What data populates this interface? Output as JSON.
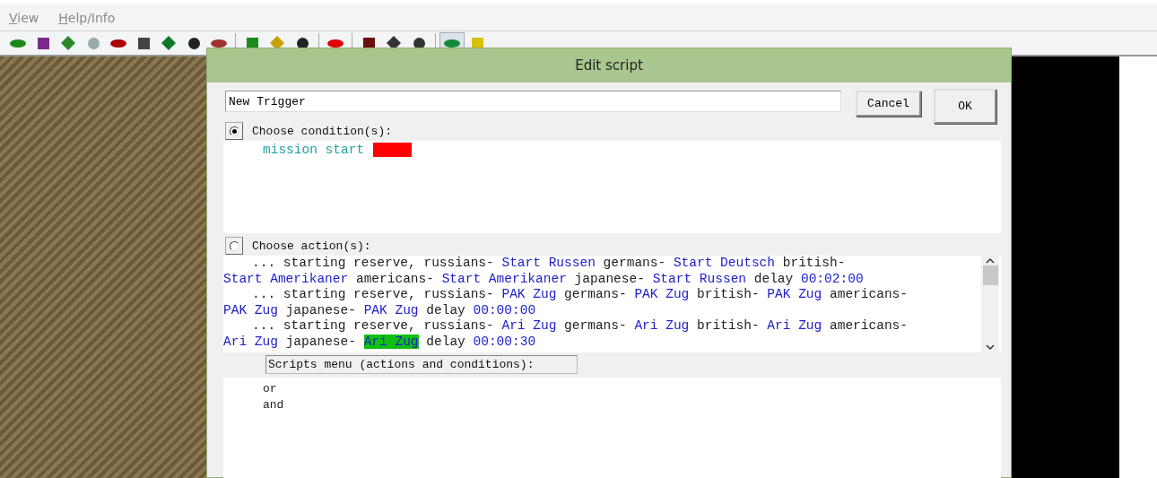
{
  "menu": [
    "View",
    "Help/Info"
  ],
  "toolbar_buttons": [
    {
      "selected": false
    },
    {
      "selected": false
    },
    {
      "selected": false
    },
    {
      "selected": false
    },
    {
      "selected": false
    },
    {
      "selected": false
    },
    {
      "selected": false
    },
    {
      "selected": false
    },
    {
      "selected": false
    },
    {
      "selected": false
    },
    {
      "selected": false
    },
    {
      "selected": false
    },
    {
      "selected": false
    },
    {
      "selected": false
    },
    {
      "selected": false
    },
    {
      "selected": false
    },
    {
      "selected": true
    },
    {
      "selected": false
    }
  ],
  "dialog": {
    "title": "Edit script",
    "name_value": "New Trigger",
    "buttons": [
      "Cancel",
      "OK"
    ],
    "conditions_section": {
      "label": "Choose condition(s):",
      "selected": true,
      "items": [
        {
          "text": "mission start",
          "flagged": true
        }
      ]
    },
    "actions_section": {
      "label": "Choose action(s):",
      "selected": false,
      "items": [
        {
          "segments": [
            {
              "text": "... starting reserve, russians-",
              "kind": "plain",
              "highlighted": false
            },
            {
              "text": "Start Russen",
              "kind": "value",
              "highlighted": false
            },
            {
              "text": "germans-",
              "kind": "plain",
              "highlighted": false
            },
            {
              "text": "Start Deutsch",
              "kind": "value",
              "highlighted": false
            },
            {
              "text": "british-",
              "kind": "plain",
              "highlighted": false
            },
            {
              "text": "Start Amerikaner",
              "kind": "value",
              "highlighted": false
            },
            {
              "text": "americans-",
              "kind": "plain",
              "highlighted": false
            },
            {
              "text": "Start Amerikaner",
              "kind": "value",
              "highlighted": false
            },
            {
              "text": "japanese-",
              "kind": "plain",
              "highlighted": false
            },
            {
              "text": "Start Russen",
              "kind": "value",
              "highlighted": false
            },
            {
              "text": "delay",
              "kind": "plain",
              "highlighted": false
            },
            {
              "text": "00:02:00",
              "kind": "value",
              "highlighted": false
            }
          ]
        },
        {
          "segments": [
            {
              "text": "... starting reserve, russians-",
              "kind": "plain",
              "highlighted": false
            },
            {
              "text": "PAK Zug",
              "kind": "value",
              "highlighted": false
            },
            {
              "text": "germans-",
              "kind": "plain",
              "highlighted": false
            },
            {
              "text": "PAK Zug",
              "kind": "value",
              "highlighted": false
            },
            {
              "text": "british-",
              "kind": "plain",
              "highlighted": false
            },
            {
              "text": "PAK Zug",
              "kind": "value",
              "highlighted": false
            },
            {
              "text": "americans-",
              "kind": "plain",
              "highlighted": false
            },
            {
              "text": "PAK Zug",
              "kind": "value",
              "highlighted": false
            },
            {
              "text": "japanese-",
              "kind": "plain",
              "highlighted": false
            },
            {
              "text": "PAK Zug",
              "kind": "value",
              "highlighted": false
            },
            {
              "text": "delay",
              "kind": "plain",
              "highlighted": false
            },
            {
              "text": "00:00:00",
              "kind": "value",
              "highlighted": false
            }
          ]
        },
        {
          "segments": [
            {
              "text": "... starting reserve, russians-",
              "kind": "plain",
              "highlighted": false
            },
            {
              "text": "Ari Zug",
              "kind": "value",
              "highlighted": false
            },
            {
              "text": "germans-",
              "kind": "plain",
              "highlighted": false
            },
            {
              "text": "Ari Zug",
              "kind": "value",
              "highlighted": false
            },
            {
              "text": "british-",
              "kind": "plain",
              "highlighted": false
            },
            {
              "text": "Ari Zug",
              "kind": "value",
              "highlighted": false
            },
            {
              "text": "americans-",
              "kind": "plain",
              "highlighted": false
            },
            {
              "text": "Ari Zug",
              "kind": "value",
              "highlighted": false
            },
            {
              "text": "japanese-",
              "kind": "plain",
              "highlighted": false
            },
            {
              "text": "Ari Zug",
              "kind": "value",
              "highlighted": true
            },
            {
              "text": "delay",
              "kind": "plain",
              "highlighted": false
            },
            {
              "text": "00:00:30",
              "kind": "value",
              "highlighted": false
            }
          ]
        }
      ]
    },
    "scripts_menu": {
      "label": "Scripts menu (actions and conditions):",
      "items": [
        "or",
        "and"
      ]
    }
  }
}
